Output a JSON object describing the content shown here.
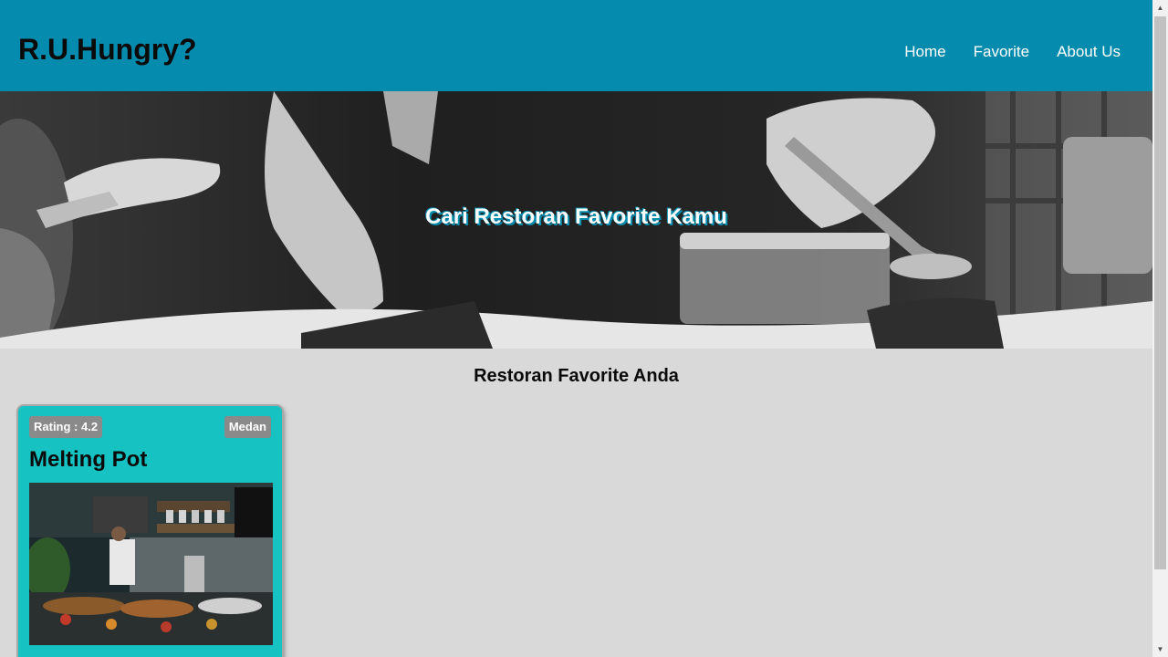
{
  "header": {
    "brand": "R.U.Hungry?",
    "nav": [
      "Home",
      "Favorite",
      "About Us"
    ]
  },
  "hero": {
    "title": "Cari Restoran Favorite Kamu"
  },
  "main": {
    "section_title": "Restoran Favorite Anda",
    "restaurants": [
      {
        "rating_label": "Rating : 4.2",
        "city": "Medan",
        "name": "Melting Pot"
      }
    ]
  },
  "colors": {
    "header": "#058bad",
    "card": "#16c2c2",
    "badge": "#8a8a8a",
    "background": "#d9d9d9"
  }
}
